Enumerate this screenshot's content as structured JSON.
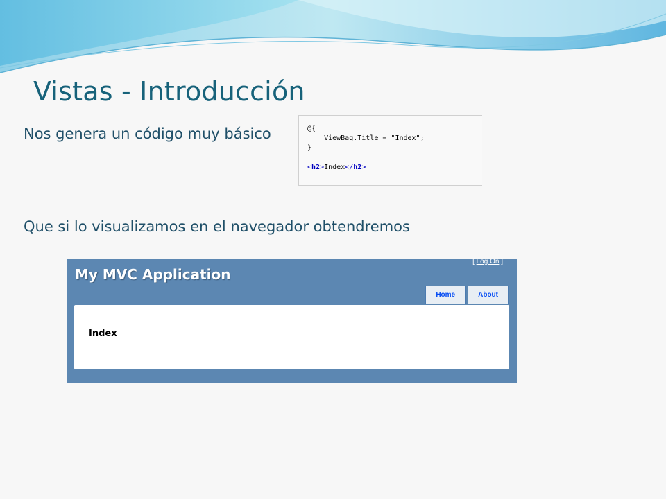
{
  "slide": {
    "title": "Vistas - Introducción",
    "bullet_1": "Nos genera un código muy básico",
    "bullet_2": "Que si lo visualizamos en el navegador obtendremos"
  },
  "code": {
    "line_1": "@{",
    "line_2_prefix": "    ViewBag.Title = ",
    "line_2_string": "\"Index\"",
    "line_2_suffix": ";",
    "line_3": "}",
    "open_tag_lt": "<",
    "open_tag_name": "h2",
    "open_tag_gt": ">",
    "inner_text": "Index",
    "close_tag_lt": "</",
    "close_tag_name": "h2",
    "close_tag_gt": ">"
  },
  "browser": {
    "app_title": "My MVC Application",
    "login_open": "[ ",
    "login_link": "Log On",
    "login_close": " ]",
    "nav": [
      "Home",
      "About"
    ],
    "heading": "Index"
  },
  "colors": {
    "title": "#17627a",
    "header_bg": "#5c87b2",
    "tab_bg": "#e8eef4",
    "tab_text": "#034af3"
  }
}
